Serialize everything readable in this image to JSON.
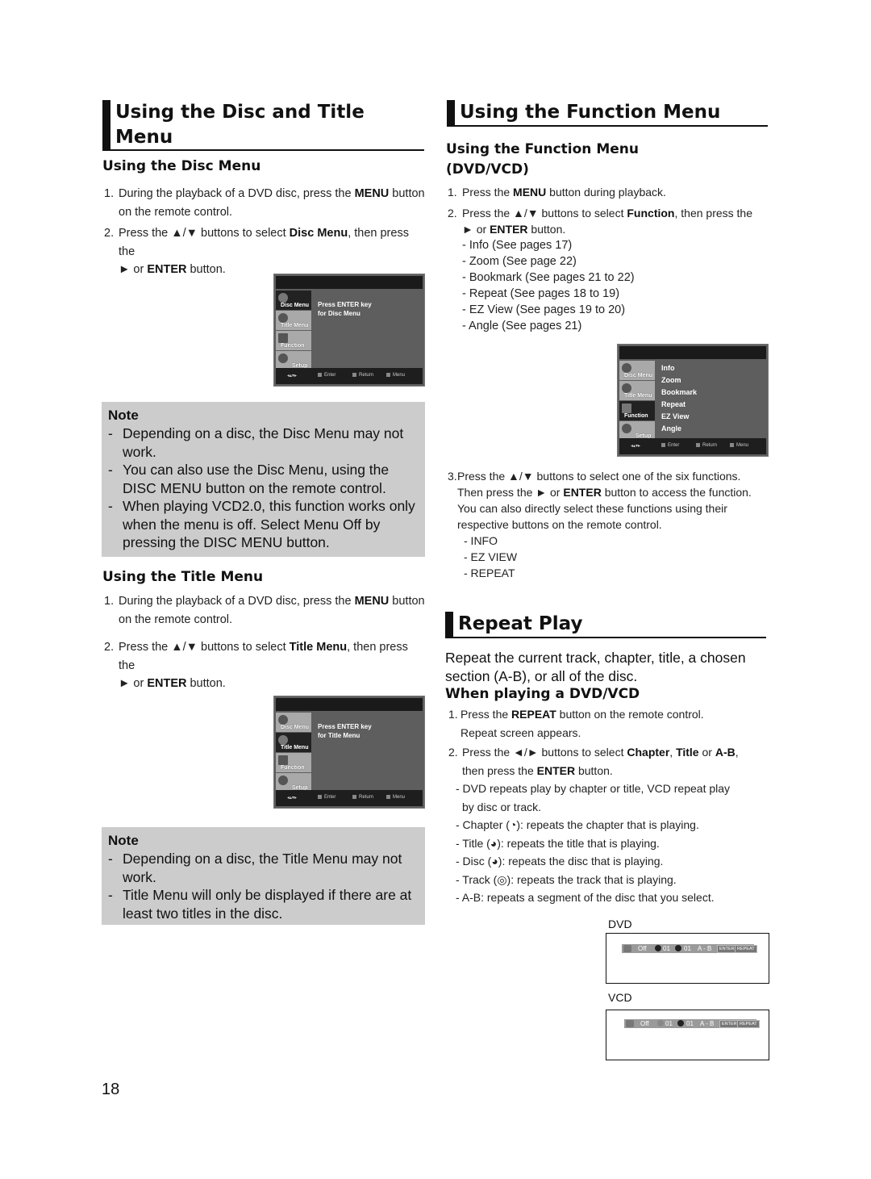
{
  "left": {
    "title": "Using the Disc and Title Menu",
    "title_line1": "Using the Disc and Title",
    "title_line2": "Menu",
    "disc_menu": {
      "heading": "Using the Disc Menu",
      "step1": {
        "num": "1.",
        "pre": "During the playback of a DVD disc, press the ",
        "bold": "MENU",
        "post": " button",
        "line2": "on the remote control."
      },
      "step2": {
        "num": "2.",
        "pre": "Press the ▲/▼ buttons to select ",
        "bold": "Disc Menu",
        "post": ", then press the",
        "line2_pre": "► or ",
        "line2_bold": "ENTER",
        "line2_post": " button."
      },
      "osd": {
        "tabs": [
          "Disc Menu",
          "Title Menu",
          "Function",
          "Setup"
        ],
        "active_tab": "Disc Menu",
        "message_line1": "Press ENTER key",
        "message_line2": "for Disc Menu",
        "footer": [
          "Enter",
          "Return",
          "Menu"
        ]
      },
      "note": {
        "title": "Note",
        "items": [
          "Depending on a disc, the Disc Menu may not work.",
          "You can also use the Disc Menu, using the DISC MENU button on the remote control.",
          "When playing VCD2.0, this function works only when the menu is off. Select Menu Off by pressing the DISC MENU button."
        ]
      }
    },
    "title_menu": {
      "heading": "Using the Title Menu",
      "step1": {
        "num": "1.",
        "pre": "During the playback of a DVD disc, press the ",
        "bold": "MENU",
        "post": " button",
        "line2": "on the remote control."
      },
      "step2": {
        "num": "2.",
        "pre": "Press the ▲/▼ buttons to select ",
        "bold": "Title Menu",
        "post": ", then press the",
        "line2_pre": "► or ",
        "line2_bold": "ENTER",
        "line2_post": " button."
      },
      "osd": {
        "tabs": [
          "Disc Menu",
          "Title Menu",
          "Function",
          "Setup"
        ],
        "active_tab": "Title Menu",
        "message_line1": "Press ENTER key",
        "message_line2": "for Title Menu",
        "footer": [
          "Enter",
          "Return",
          "Menu"
        ]
      },
      "note": {
        "title": "Note",
        "items": [
          "Depending on a disc, the Title Menu may not work.",
          "Title Menu will only be displayed if there are at least two titles in the disc."
        ]
      }
    }
  },
  "right": {
    "function_menu": {
      "title": "Using the Function Menu",
      "subheading_line1": "Using the Function Menu",
      "subheading_line2": "(DVD/VCD)",
      "step1": {
        "num": "1.",
        "pre": "Press the ",
        "bold": "MENU",
        "post": " button during playback."
      },
      "step2": {
        "num": "2.",
        "pre": "Press the ▲/▼ buttons to select ",
        "bold": "Function",
        "post": ", then press the",
        "line2_pre": "► or ",
        "line2_bold": "ENTER",
        "line2_post": " button."
      },
      "functions": [
        "- Info (See pages 17)",
        "- Zoom (See page 22)",
        "- Bookmark (See pages 21 to 22)",
        "- Repeat (See pages 18 to 19)",
        "- EZ View (See pages 19 to 20)",
        "- Angle (See pages 21)"
      ],
      "osd": {
        "tabs": [
          "Disc Menu",
          "Title Menu",
          "Function",
          "Setup"
        ],
        "active_tab": "Function",
        "items": [
          "Info",
          "Zoom",
          "Bookmark",
          "Repeat",
          "EZ View",
          "Angle"
        ],
        "footer": [
          "Enter",
          "Return",
          "Menu"
        ]
      },
      "step3": {
        "num": "3.",
        "line1": "Press the ▲/▼ buttons to select one of the six functions.",
        "line2_pre": "Then press the ► or ",
        "line2_bold": "ENTER",
        "line2_post": " button to access the function.",
        "line3": "You can also directly select these functions using their",
        "line4": "respective buttons on the remote control."
      },
      "direct_buttons": [
        "- INFO",
        "- EZ VIEW",
        "- REPEAT"
      ]
    },
    "repeat_play": {
      "title": "Repeat Play",
      "intro_line1": "Repeat the current track, chapter, title, a chosen",
      "intro_line2": "section (A-B), or all of the disc.",
      "subheading": "When playing a DVD/VCD",
      "step1": {
        "num": "1.",
        "pre": "Press the ",
        "bold": "REPEAT",
        "post": " button on the remote control.",
        "line2": "Repeat screen appears."
      },
      "step2": {
        "num": "2.",
        "pre": "Press the ◄/► buttons to select ",
        "bold1": "Chapter",
        "mid1": ", ",
        "bold2": "Title",
        "mid2": " or ",
        "bold3": "A-B",
        "post": ",",
        "line2_pre": "then press the ",
        "line2_bold": "ENTER",
        "line2_post": " button."
      },
      "bullets": [
        "- DVD repeats play by chapter or title, VCD repeat play",
        "by disc or track.",
        "- Chapter (◔): repeats the chapter that is playing.",
        "- Title (◕): repeats the title that is playing.",
        "- Disc (◕): repeats the disc that is playing.",
        "- Track (◎): repeats the track that is playing.",
        "- A-B: repeats a segment of the disc that you select."
      ],
      "dvd_label": "DVD",
      "vcd_label": "VCD",
      "dvd_bar": {
        "mode": "Off",
        "chapter": "01",
        "title": "01",
        "ab": "A - B",
        "enter": "ENTER",
        "repeat": "REPEAT"
      },
      "vcd_bar": {
        "mode": "Off",
        "track": "01",
        "disc": "01",
        "ab": "A - B",
        "enter": "ENTER",
        "repeat": "REPEAT"
      }
    }
  },
  "page_number": "18"
}
